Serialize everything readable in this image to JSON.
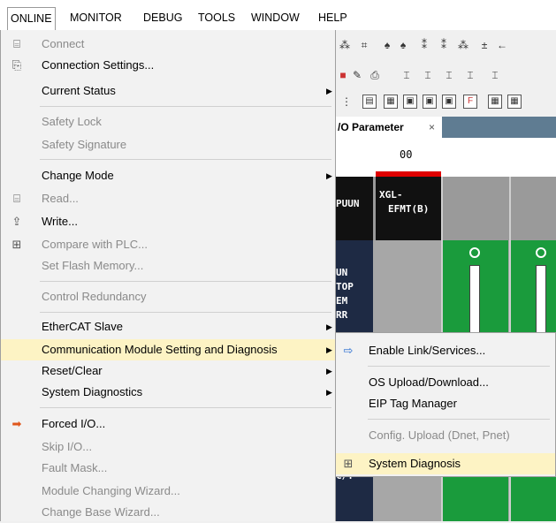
{
  "menubar": {
    "items": [
      "ONLINE",
      "MONITOR",
      "DEBUG",
      "TOOLS",
      "WINDOW",
      "HELP"
    ]
  },
  "toolbar_row3_labels": [
    "F"
  ],
  "document_tab": {
    "label": "/O Parameter",
    "close": "×"
  },
  "rack": {
    "slot_number": "00",
    "cpu_label": "PUUN",
    "module_label_line1": "XGL-",
    "module_label_line2": "EFMT(B)",
    "led_labels": [
      "UN",
      "TOP",
      "EM",
      "RR"
    ],
    "side_label": "C/T"
  },
  "menu": {
    "items": [
      {
        "label": "Connect",
        "enabled": false,
        "icon": "connect-icon"
      },
      {
        "label": "Connection Settings...",
        "enabled": true,
        "icon": "connection-settings-icon"
      },
      {
        "label": "Current Status",
        "enabled": true,
        "submenu": true
      },
      {
        "label": "Safety Lock",
        "enabled": false
      },
      {
        "label": "Safety Signature",
        "enabled": false
      },
      {
        "label": "Change Mode",
        "enabled": true,
        "submenu": true
      },
      {
        "label": "Read...",
        "enabled": false,
        "icon": "read-icon"
      },
      {
        "label": "Write...",
        "enabled": true,
        "icon": "write-icon"
      },
      {
        "label": "Compare with PLC...",
        "enabled": false,
        "icon": "compare-icon"
      },
      {
        "label": "Set Flash Memory...",
        "enabled": false
      },
      {
        "label": "Control Redundancy",
        "enabled": false
      },
      {
        "label": "EtherCAT Slave",
        "enabled": true,
        "submenu": true
      },
      {
        "label": "Communication Module Setting and Diagnosis",
        "enabled": true,
        "submenu": true,
        "highlighted": true
      },
      {
        "label": "Reset/Clear",
        "enabled": true,
        "submenu": true
      },
      {
        "label": "System Diagnostics",
        "enabled": true,
        "submenu": true
      },
      {
        "label": "Forced I/O...",
        "enabled": true,
        "icon": "forced-io-icon"
      },
      {
        "label": "Skip I/O...",
        "enabled": false
      },
      {
        "label": "Fault Mask...",
        "enabled": false
      },
      {
        "label": "Module Changing Wizard...",
        "enabled": false
      },
      {
        "label": "Change Base Wizard...",
        "enabled": false
      }
    ]
  },
  "submenu": {
    "items": [
      {
        "label": "Enable Link/Services...",
        "enabled": true,
        "icon": "enable-link-icon"
      },
      {
        "label": "OS Upload/Download...",
        "enabled": true
      },
      {
        "label": "EIP Tag Manager",
        "enabled": true
      },
      {
        "label": "Config. Upload (Dnet, Pnet)",
        "enabled": false
      },
      {
        "label": "System Diagnosis",
        "enabled": true,
        "highlighted": true,
        "icon": "system-diagnosis-icon"
      }
    ]
  },
  "colors": {
    "highlight": "#fdf3c4",
    "disabled_text": "#8a8a8a",
    "tab_bar": "#5f7c92",
    "module_green": "#1a9b3c",
    "slot_red": "#e00000"
  }
}
